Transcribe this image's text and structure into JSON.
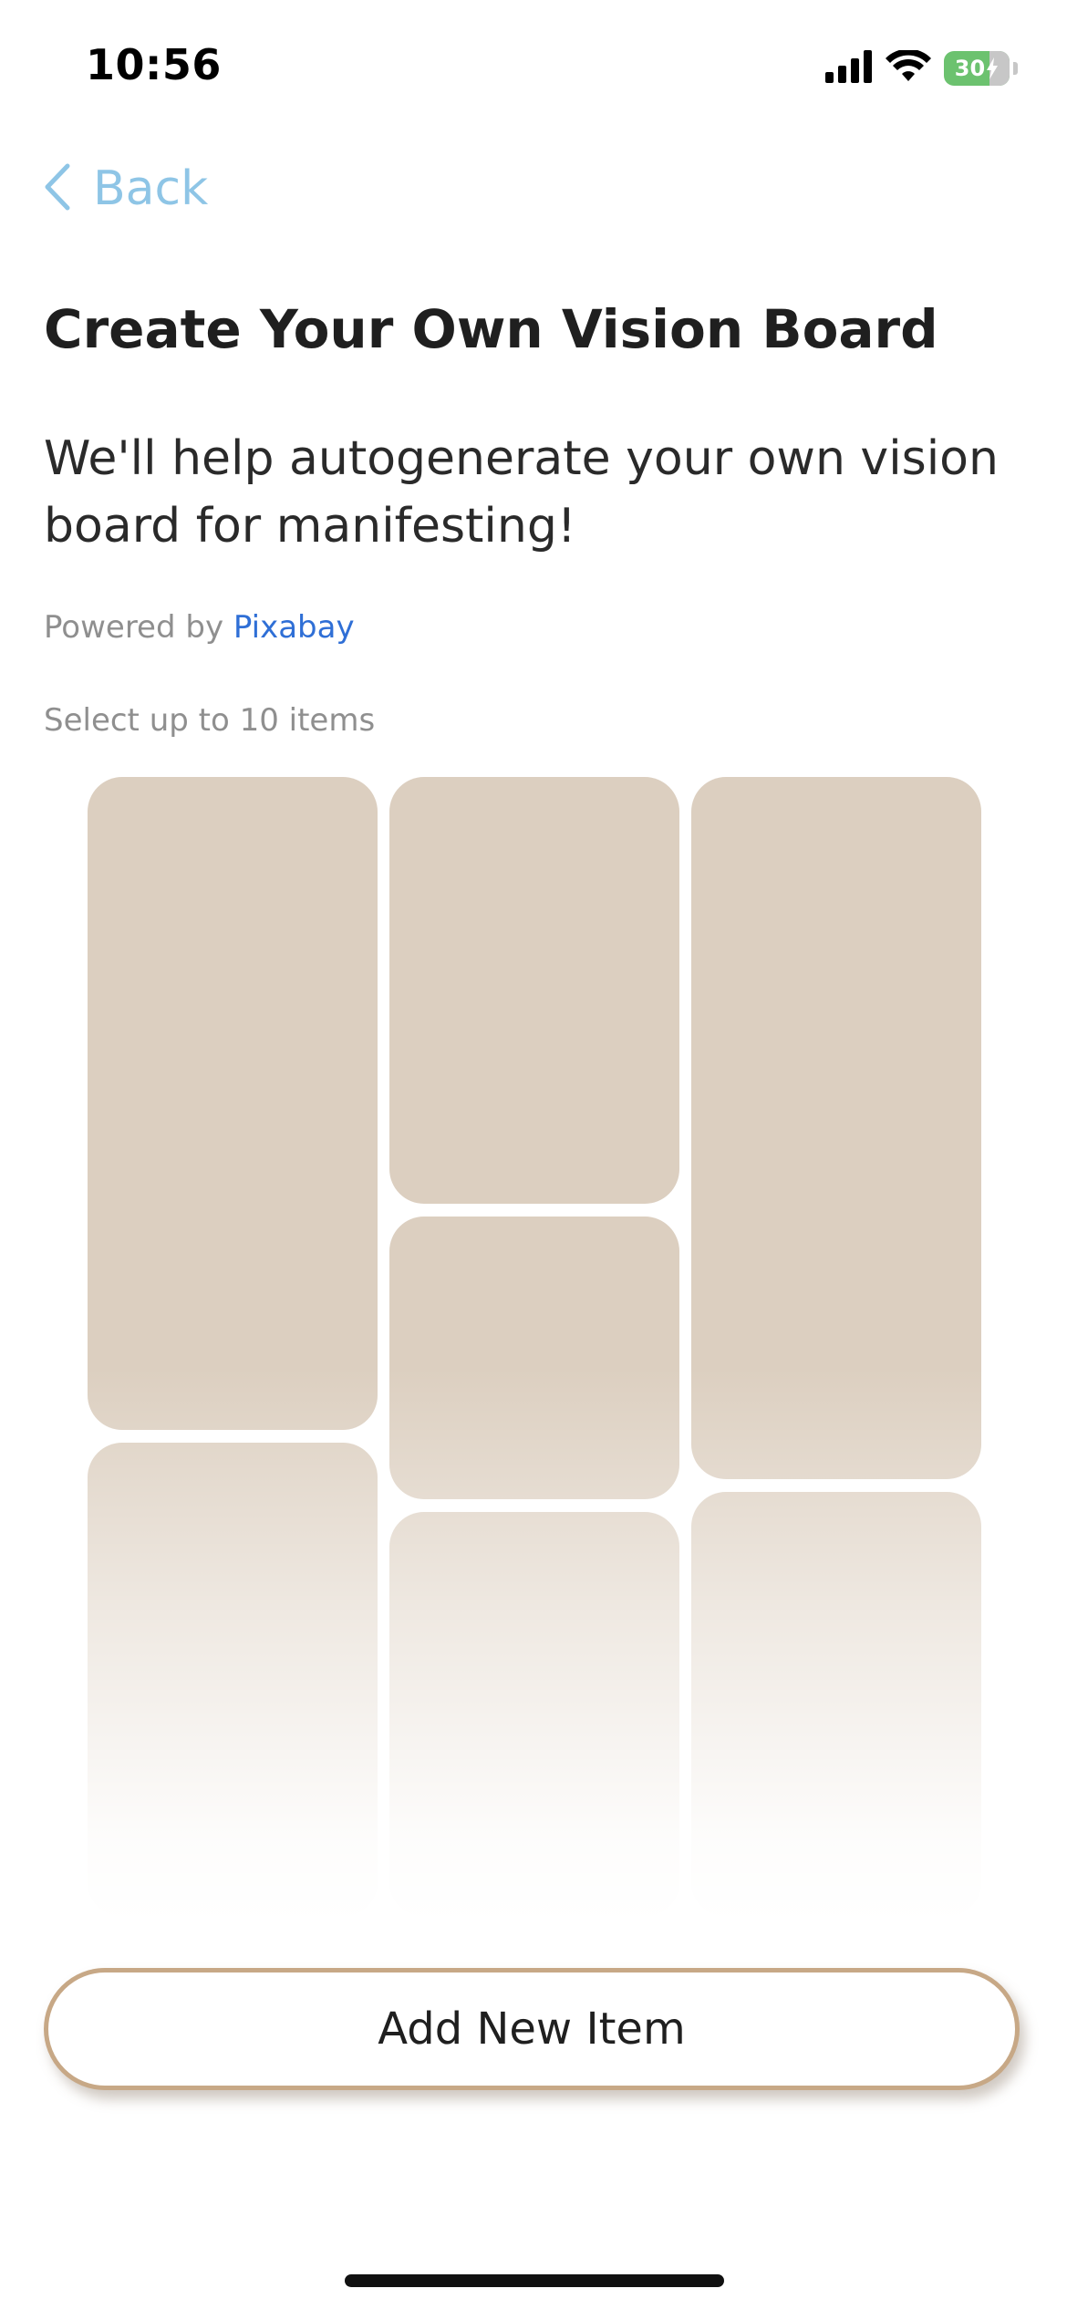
{
  "status_bar": {
    "time": "10:56",
    "battery": "30",
    "icons": [
      "signal-bars-icon",
      "wifi-icon",
      "battery-charging-icon"
    ]
  },
  "nav": {
    "back_label": "Back",
    "back_icon": "chevron-left-icon"
  },
  "header": {
    "title": "Create Your Own Vision Board",
    "subtitle": "We'll help autogenerate your own vision board for manifesting!"
  },
  "attribution": {
    "prefix": "Powered by",
    "link": "Pixabay"
  },
  "selection_hint": "Select up to 10 items",
  "grid": {
    "tile_count": 7
  },
  "actions": {
    "add_label": "Add New Item"
  },
  "colors": {
    "accent_blue": "#8ec5e6",
    "link_blue": "#2f6fd6",
    "tile_placeholder": "#dccfc0",
    "button_border": "#c7a886",
    "battery_green": "#6cc26f"
  }
}
